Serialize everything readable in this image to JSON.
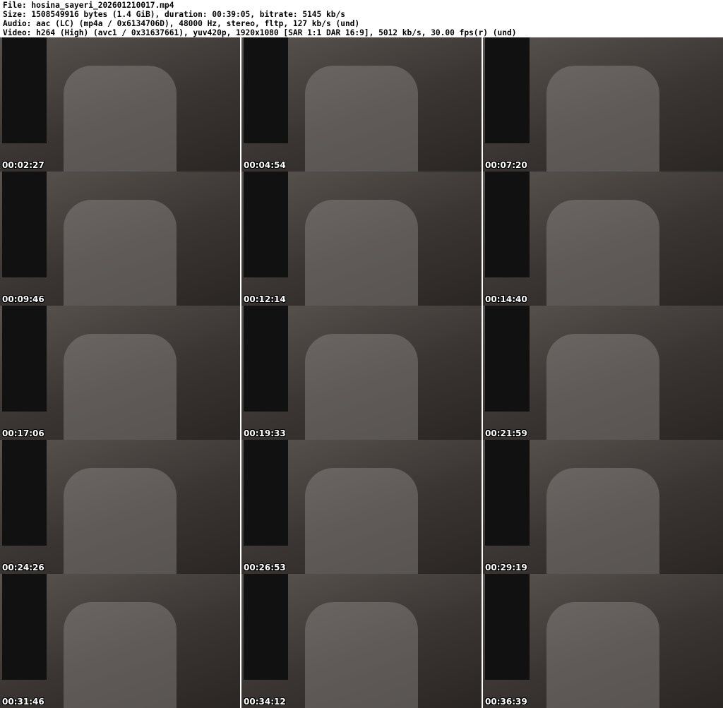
{
  "header": {
    "file": "File: hosina_sayeri_202601210017.mp4",
    "size": "Size: 1508549916 bytes (1.4 GiB), duration: 00:39:05, bitrate: 5145 kb/s",
    "audio": "Audio: aac (LC) (mp4a / 0x6134706D), 48000 Hz, stereo, fltp, 127 kb/s (und)",
    "video": "Video: h264 (High) (avc1 / 0x31637661), yuv420p, 1920x1080 [SAR 1:1 DAR 16:9], 5012 kb/s, 30.00 fps(r) (und)"
  },
  "thumbnails": [
    {
      "timestamp": "00:02:27"
    },
    {
      "timestamp": "00:04:54"
    },
    {
      "timestamp": "00:07:20"
    },
    {
      "timestamp": "00:09:46"
    },
    {
      "timestamp": "00:12:14"
    },
    {
      "timestamp": "00:14:40"
    },
    {
      "timestamp": "00:17:06"
    },
    {
      "timestamp": "00:19:33"
    },
    {
      "timestamp": "00:21:59"
    },
    {
      "timestamp": "00:24:26"
    },
    {
      "timestamp": "00:26:53"
    },
    {
      "timestamp": "00:29:19"
    },
    {
      "timestamp": "00:31:46"
    },
    {
      "timestamp": "00:34:12"
    },
    {
      "timestamp": "00:36:39"
    }
  ]
}
